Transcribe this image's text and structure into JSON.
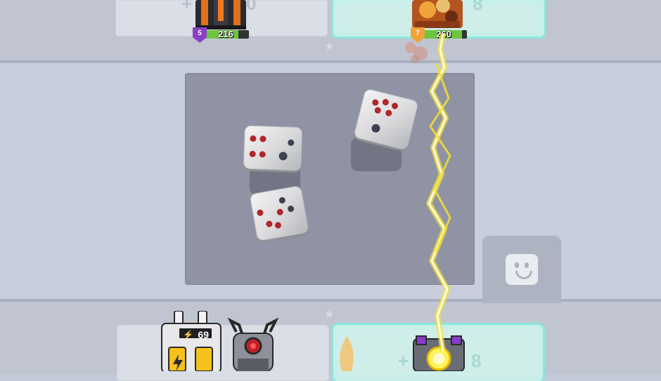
{
  "opponent_units": [
    {
      "name": "dark-tower-unit",
      "level": "5",
      "hp": "216",
      "hp_fraction": 0.78,
      "shield_color": "#8b3fc7"
    },
    {
      "name": "lava-unit",
      "level": "7",
      "hp": "260",
      "hp_fraction": 0.9,
      "shield_color": "#f2a23a"
    }
  ],
  "player_units": [
    {
      "name": "battery-unit",
      "energy": "69"
    },
    {
      "name": "crab-unit"
    },
    {
      "name": "orb-unit"
    }
  ],
  "slots": {
    "ghost_plus": "+",
    "ghost_zero": "0",
    "ghost_eight": "8"
  },
  "dice": [
    {
      "name": "die-four-two",
      "value": 4
    },
    {
      "name": "die-five-one",
      "value": 5
    },
    {
      "name": "die-two-four",
      "value": 2
    }
  ],
  "colors": {
    "hp_green": "#6cc63e",
    "active_slot_glow": "#8ae6dc",
    "lightning": "#fff35a",
    "pip_red": "#b0262a"
  },
  "buttons": {
    "emote_icon": "smiley-face-icon"
  }
}
